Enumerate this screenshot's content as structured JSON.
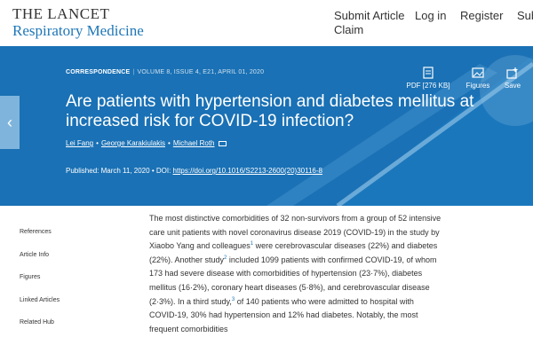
{
  "header": {
    "journal_line1": "THE LANCET",
    "journal_line2": "Respiratory Medicine",
    "nav": {
      "submit": "Submit Article Claim",
      "login": "Log in",
      "register": "Register",
      "subscribe": "Subs"
    }
  },
  "hero": {
    "prev_arrow": "‹",
    "article_type": "CORRESPONDENCE",
    "issue": "VOLUME 8, ISSUE 4, E21, APRIL 01, 2020",
    "title": "Are patients with hypertension and diabetes mellitus at increased risk for COVID-19 infection?",
    "authors": [
      "Lei Fang",
      "George Karakiulakis",
      "Michael Roth"
    ],
    "published_label": "Published: March 11, 2020",
    "doi_label": "DOI:",
    "doi": "https://doi.org/10.1016/S2213-2600(20)30116-8",
    "tools": {
      "pdf": "PDF [276 KB]",
      "figures": "Figures",
      "save": "Save"
    }
  },
  "sidebar": {
    "items": [
      "References",
      "Article Info",
      "Figures",
      "Linked Articles",
      "Related Hub"
    ]
  },
  "body": {
    "p1": "The most distinctive comorbidities of 32 non-survivors from a group of 52 intensive care unit patients with novel coronavirus disease 2019 (COVID-19) in the study by Xiaobo Yang and colleagues",
    "ref1": "1",
    "p2": " were cerebrovascular diseases (22%) and diabetes (22%). Another study",
    "ref2": "2",
    "p3": " included 1099 patients with confirmed COVID-19, of whom 173 had severe disease with comorbidities of hypertension (23·7%), diabetes mellitus (16·2%), coronary heart diseases (5·8%), and cerebrovascular disease (2·3%). In a third study,",
    "ref3": "3",
    "p4": " of 140 patients who were admitted to hospital with COVID-19, 30% had hypertension and 12% had diabetes. Notably, the most frequent comorbidities"
  },
  "colors": {
    "hero_bg": "#1a71b5",
    "accent": "#1e76b6"
  }
}
